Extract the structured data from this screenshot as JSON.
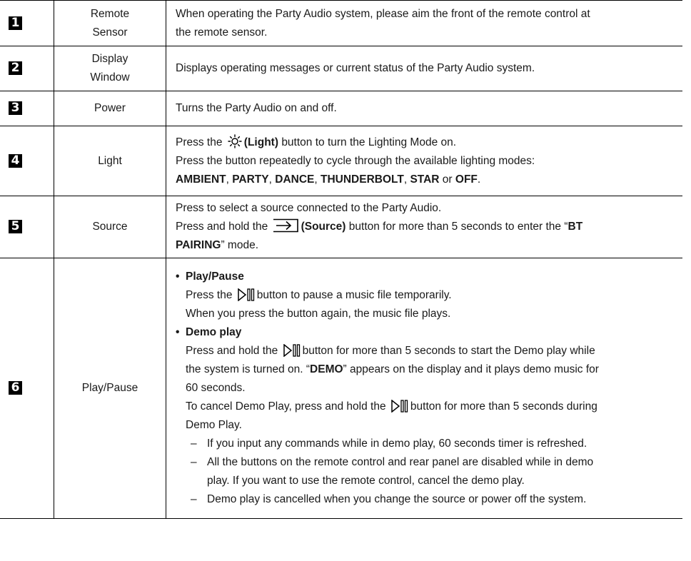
{
  "rows": [
    {
      "num": "1",
      "name_line1": "Remote",
      "name_line2": "Sensor",
      "desc_line1": "When operating the Party Audio system, please aim the front of the remote control at",
      "desc_line2": "the remote sensor."
    },
    {
      "num": "2",
      "name_line1": "Display",
      "name_line2": "Window",
      "desc_line1": "Displays operating messages or current status of the Party Audio system."
    },
    {
      "num": "3",
      "name_line1": "Power",
      "desc_line1": "Turns the Party Audio on and off."
    },
    {
      "num": "4",
      "name_line1": "Light",
      "press_the": "Press the",
      "light_label": "(Light)",
      "light_suffix": "button to turn the Lighting Mode on.",
      "desc_line2": "Press the button repeatedly to cycle through the available lighting modes:",
      "modes": [
        "AMBIENT",
        "PARTY",
        "DANCE",
        "THUNDERBOLT",
        "STAR",
        "OFF"
      ],
      "sep": ", ",
      "or": " or ",
      "period": "."
    },
    {
      "num": "5",
      "name_line1": "Source",
      "desc_line1": "Press to select a source connected to the Party Audio.",
      "press_hold": "Press and hold the",
      "source_label": "(Source)",
      "source_suffix": "button for more than 5 seconds to enter the “",
      "bt": "BT",
      "pairing": "PAIRING",
      "mode_suffix": "” mode."
    },
    {
      "num": "6",
      "name_line1": "Play/Pause",
      "bullet1": "Play/Pause",
      "b1_pre": "Press the",
      "b1_post": "button to pause a music file temporarily.",
      "b1_line2": "When you press the button again, the music file plays.",
      "bullet2": "Demo play",
      "b2_pre": "Press and hold the",
      "b2_post": "button for more than 5 seconds to start the Demo play while",
      "b2_l2_pre": "the system is turned on. “",
      "demo": "DEMO",
      "b2_l2_post": "” appears on the display and it plays demo music for",
      "b2_l3": "60 seconds.",
      "b2_l4_pre": "To cancel Demo Play, press and hold the",
      "b2_l4_post": "button for more than 5 seconds during",
      "b2_l5": "Demo Play.",
      "dash1": "If you input any commands while in demo play, 60 seconds timer is refreshed.",
      "dash2_l1": "All the buttons on the remote control and rear panel are disabled while in demo",
      "dash2_l2": "play. If you want to use the remote control, cancel the demo play.",
      "dash3": "Demo play is cancelled when you change the source or power off the system."
    }
  ]
}
